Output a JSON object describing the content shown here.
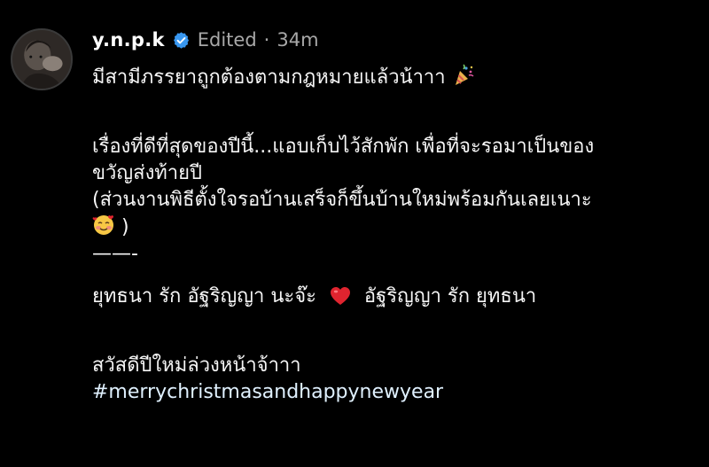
{
  "post": {
    "username": "y.n.p.k",
    "edited_label": "Edited",
    "separator": "·",
    "time_ago": "34m",
    "lines": {
      "l1": "มีสามีภรรยาถูกต้องตามกฎหมายแล้วน้าาา",
      "l2": "เรื่องที่ดีที่สุดของปีนี้...แอบเก็บไว้สักพัก เพื่อที่จะรอมาเป็นของ",
      "l3": "ขวัญส่งท้ายปี",
      "l4": "(ส่วนงานพิธีตั้งใจรอบ้านเสร็จก็ขึ้นบ้านใหม่พร้อมกันเลยเนาะ",
      "l5_end": ")",
      "l6": "——-",
      "l7_a": "ยุทธนา รัก อัฐริญญา นะจ๊ะ",
      "l7_b": "อัฐริญญา รัก ยุทธนา",
      "l8": "สวัสดีปีใหม่ล่วงหน้าจ้าาา",
      "hashtag": "#merrychristmasandhappynewyear"
    },
    "icons": {
      "verified": "verified-badge-icon",
      "party": "party-popper-emoji",
      "smile": "smiling-face-with-hearts-emoji",
      "heart": "red-heart-emoji"
    },
    "colors": {
      "verified": "#3897f0",
      "meta": "#a8a8a8",
      "heart": "#e0242f"
    }
  }
}
